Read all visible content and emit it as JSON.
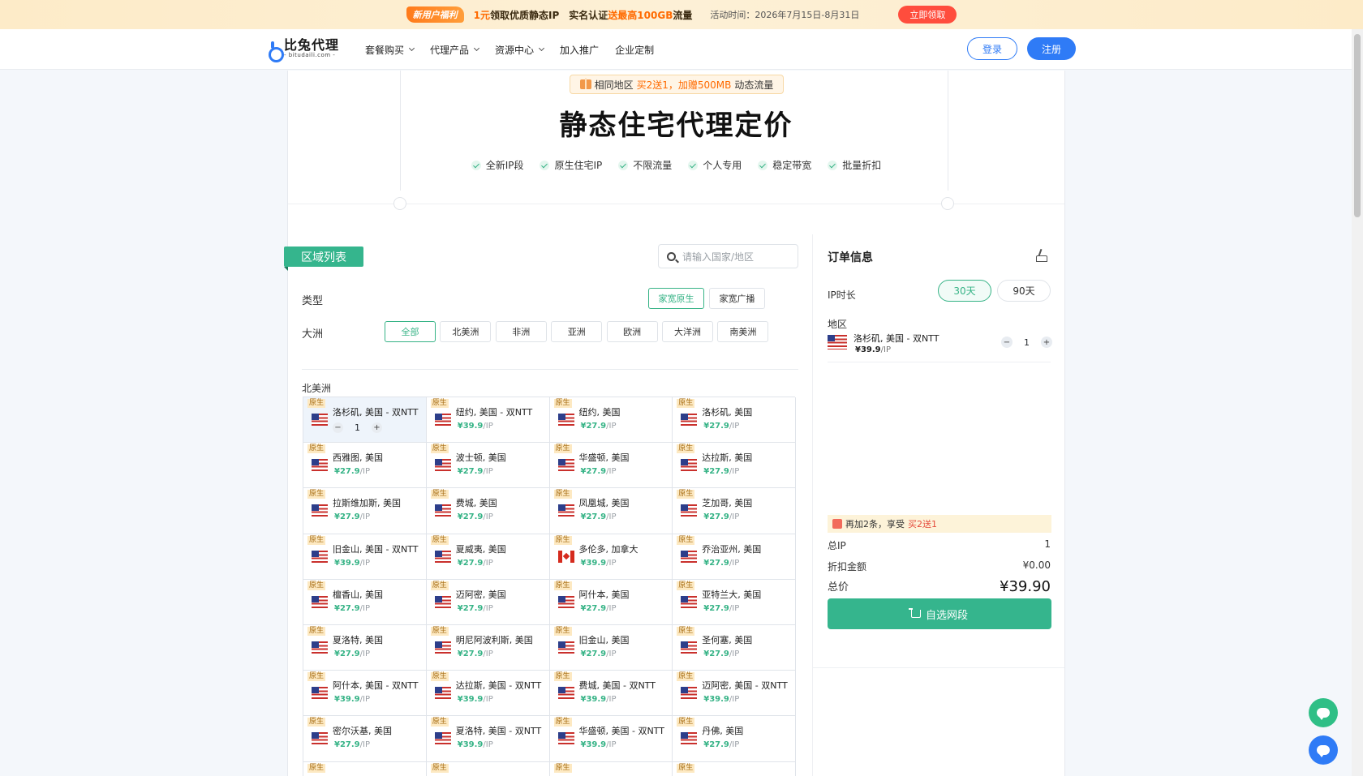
{
  "promo_banner": {
    "tag": "新用户福利",
    "offer_prefix": "1元",
    "offer_text": "领取优质静态IP",
    "verify_prefix": "实名认证",
    "verify_highlight": "送最高100GB",
    "verify_suffix": "流量",
    "activity_time": "活动时间：2026年7月15日-8月31日",
    "claim_button": "立即领取"
  },
  "header": {
    "logo_name": "比兔代理",
    "logo_domain": "- bitudaili.com -",
    "nav": [
      {
        "label": "套餐购买",
        "has_dropdown": true
      },
      {
        "label": "代理产品",
        "has_dropdown": true
      },
      {
        "label": "资源中心",
        "has_dropdown": true
      },
      {
        "label": "加入推广",
        "has_dropdown": false
      },
      {
        "label": "企业定制",
        "has_dropdown": false
      }
    ],
    "login": "登录",
    "register": "注册"
  },
  "hero": {
    "gift_prefix": "相同地区",
    "gift_highlight": "买2送1，加赠500MB",
    "gift_suffix": "动态流量",
    "title": "静态住宅代理定价",
    "features": [
      "全新IP段",
      "原生住宅IP",
      "不限流量",
      "个人专用",
      "稳定带宽",
      "批量折扣"
    ]
  },
  "region_panel": {
    "tag": "区域列表",
    "search_placeholder": "请输入国家/地区",
    "type_label": "类型",
    "types": [
      "家宽原生",
      "家宽广播"
    ],
    "type_selected": "家宽原生",
    "continent_label": "大洲",
    "continents": [
      "全部",
      "北美洲",
      "非洲",
      "亚洲",
      "欧洲",
      "大洋洲",
      "南美洲"
    ],
    "continent_selected": "全部",
    "section_title": "北美洲",
    "native_badge": "原生",
    "price_unit": "/IP",
    "locations": [
      {
        "name": "洛杉矶, 美国 - 双NTT",
        "price": "¥39.9",
        "flag": "us",
        "selected": true,
        "qty": "1"
      },
      {
        "name": "纽约, 美国 - 双NTT",
        "price": "¥39.9",
        "flag": "us"
      },
      {
        "name": "纽约, 美国",
        "price": "¥27.9",
        "flag": "us"
      },
      {
        "name": "洛杉矶, 美国",
        "price": "¥27.9",
        "flag": "us"
      },
      {
        "name": "西雅图, 美国",
        "price": "¥27.9",
        "flag": "us"
      },
      {
        "name": "波士顿, 美国",
        "price": "¥27.9",
        "flag": "us"
      },
      {
        "name": "华盛顿, 美国",
        "price": "¥27.9",
        "flag": "us"
      },
      {
        "name": "达拉斯, 美国",
        "price": "¥27.9",
        "flag": "us"
      },
      {
        "name": "拉斯维加斯, 美国",
        "price": "¥27.9",
        "flag": "us"
      },
      {
        "name": "费城, 美国",
        "price": "¥27.9",
        "flag": "us"
      },
      {
        "name": "凤凰城, 美国",
        "price": "¥27.9",
        "flag": "us"
      },
      {
        "name": "芝加哥, 美国",
        "price": "¥27.9",
        "flag": "us"
      },
      {
        "name": "旧金山, 美国 - 双NTT",
        "price": "¥39.9",
        "flag": "us"
      },
      {
        "name": "夏威夷, 美国",
        "price": "¥27.9",
        "flag": "us"
      },
      {
        "name": "多伦多, 加拿大",
        "price": "¥39.9",
        "flag": "ca"
      },
      {
        "name": "乔治亚州, 美国",
        "price": "¥27.9",
        "flag": "us"
      },
      {
        "name": "檀香山, 美国",
        "price": "¥27.9",
        "flag": "us"
      },
      {
        "name": "迈阿密, 美国",
        "price": "¥27.9",
        "flag": "us"
      },
      {
        "name": "阿什本, 美国",
        "price": "¥27.9",
        "flag": "us"
      },
      {
        "name": "亚特兰大, 美国",
        "price": "¥27.9",
        "flag": "us"
      },
      {
        "name": "夏洛特, 美国",
        "price": "¥27.9",
        "flag": "us"
      },
      {
        "name": "明尼阿波利斯, 美国",
        "price": "¥27.9",
        "flag": "us"
      },
      {
        "name": "旧金山, 美国",
        "price": "¥27.9",
        "flag": "us"
      },
      {
        "name": "圣何塞, 美国",
        "price": "¥27.9",
        "flag": "us"
      },
      {
        "name": "阿什本, 美国 - 双NTT",
        "price": "¥39.9",
        "flag": "us"
      },
      {
        "name": "达拉斯, 美国 - 双NTT",
        "price": "¥39.9",
        "flag": "us"
      },
      {
        "name": "费城, 美国 - 双NTT",
        "price": "¥39.9",
        "flag": "us"
      },
      {
        "name": "迈阿密, 美国 - 双NTT",
        "price": "¥39.9",
        "flag": "us"
      },
      {
        "name": "密尔沃基, 美国",
        "price": "¥27.9",
        "flag": "us"
      },
      {
        "name": "夏洛特, 美国 - 双NTT",
        "price": "¥39.9",
        "flag": "us"
      },
      {
        "name": "华盛顿, 美国 - 双NTT",
        "price": "¥39.9",
        "flag": "us"
      },
      {
        "name": "丹佛, 美国",
        "price": "¥27.9",
        "flag": "us"
      }
    ]
  },
  "order": {
    "title": "订单信息",
    "ip_duration_label": "IP时长",
    "durations": [
      "30天",
      "90天"
    ],
    "duration_selected": "30天",
    "region_label": "地区",
    "item": {
      "name": "洛杉矶, 美国 - 双NTT",
      "price": "¥39.9",
      "unit": "/IP",
      "qty": "1"
    },
    "promo_prefix": "再加2条，享受",
    "promo_highlight": "买2送1",
    "total_ip_label": "总IP",
    "total_ip_value": "1",
    "discount_label": "折扣金额",
    "discount_value": "¥0.00",
    "total_label": "总价",
    "total_value": "¥39.90",
    "select_button": "自选网段"
  }
}
